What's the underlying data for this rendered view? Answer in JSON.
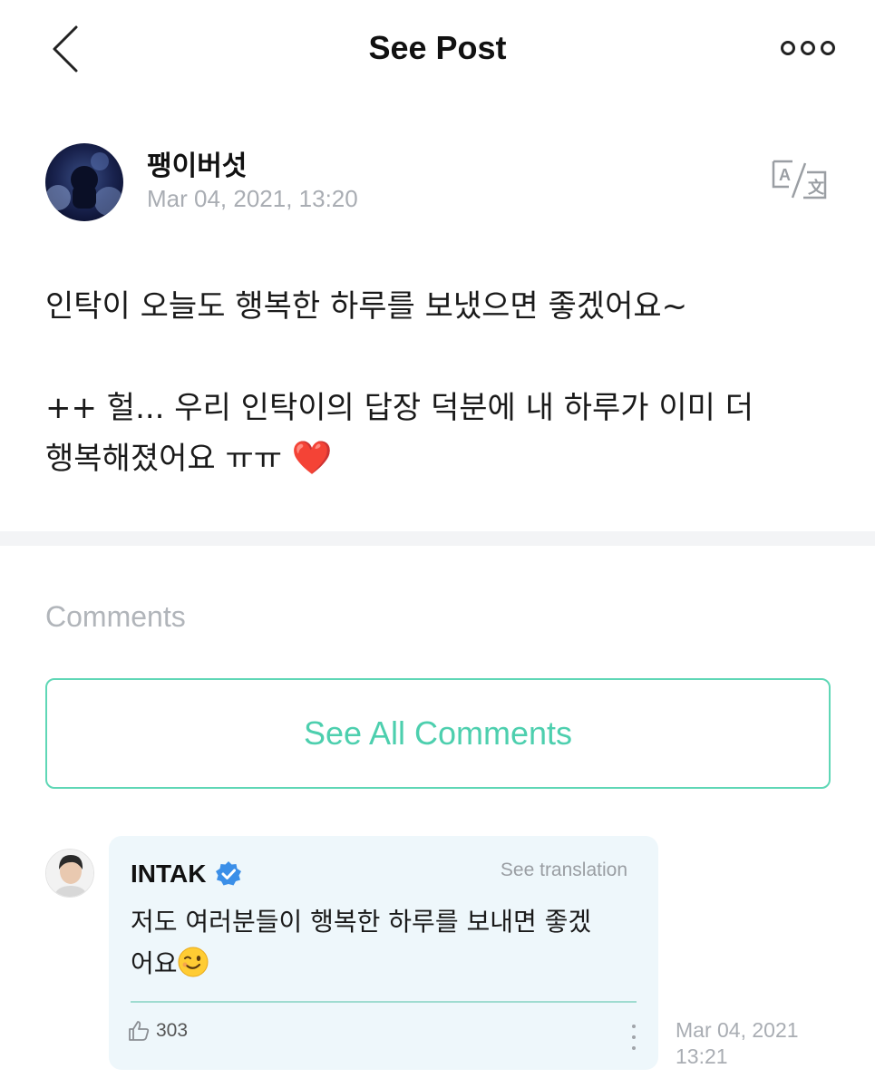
{
  "header": {
    "title": "See Post",
    "back_icon": "chevron-left-icon",
    "more_icon": "more-horizontal-icon"
  },
  "post": {
    "author": "팽이버섯",
    "timestamp": "Mar 04, 2021, 13:20",
    "translate_icon": "translate-icon",
    "line1": "인탁이 오늘도 행복한 하루를 보냈으면 좋겠어요~",
    "line2": "++ 헐... 우리 인탁이의 답장 덕분에 내 하루가 이미 더",
    "line3": "행복해졌어요 ㅠㅠ",
    "heart": "❤️"
  },
  "comments": {
    "label": "Comments",
    "see_all_label": "See All Comments",
    "accent_color": "#4dcfae",
    "items": [
      {
        "author": "INTAK",
        "verified": true,
        "see_translation": "See translation",
        "line1": "저도 여러분들이 행복한 하루를 보내면 좋겠",
        "line2": "어요",
        "emoji": "winking-face",
        "likes": "303",
        "date": "Mar 04, 2021",
        "time": "13:21"
      }
    ]
  }
}
